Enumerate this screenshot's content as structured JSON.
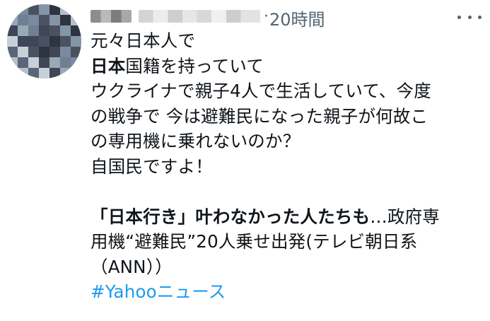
{
  "tweet": {
    "time": "20時間",
    "more_icon": "more-horizontal-icon",
    "lines": [
      {
        "text": "元々日本人で"
      },
      {
        "bold": "日本",
        "text": "国籍を持っていて"
      },
      {
        "text": "ウクライナで親子4人で生活していて、今度"
      },
      {
        "text": "の戦争で 今は避難民になった親子が何故こ"
      },
      {
        "text": "の専用機に乗れないのか？"
      },
      {
        "text": "自国民ですよ！"
      }
    ],
    "card": {
      "title_bold": "「日本行き」叶わなかった人たちも",
      "title_rest_line1": "…政府専",
      "title_line2": "用機“避難民”20人乗せ出発(テレビ朝日系",
      "title_line3": "（ANN））"
    },
    "hashtag": "#Yahooニュース"
  },
  "colors": {
    "text": "#0f1419",
    "secondary": "#536471",
    "link": "#1d9bf0"
  }
}
